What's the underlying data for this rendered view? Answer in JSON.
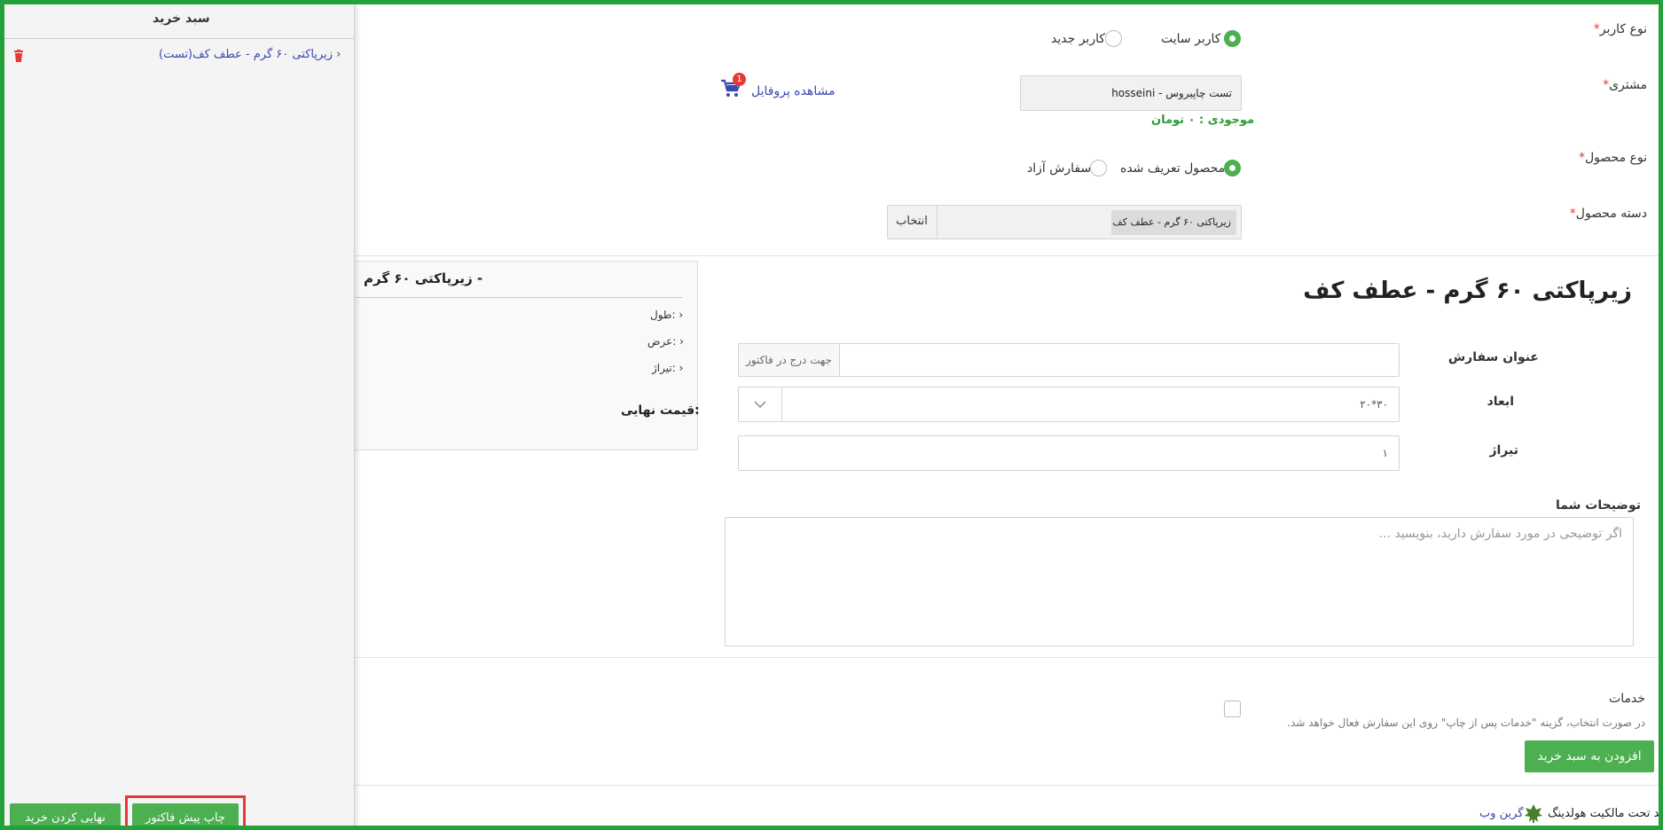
{
  "form": {
    "user_type": {
      "label": "نوع کاربر",
      "options": [
        "کاربر سایت",
        "کاربر جدید"
      ]
    },
    "customer": {
      "label": "مشتری",
      "value": "تست چاپیروس - hosseini",
      "balance": "موجودی : ۰ تومان",
      "profile_link": "مشاهده پروفایل",
      "cart_badge": "1"
    },
    "product_type": {
      "label": "نوع محصول",
      "options": [
        "محصول تعریف شده",
        "سفارش آزاد"
      ]
    },
    "category": {
      "label": "دسته محصول",
      "chip": "زیرپاکتی ۶۰ گرم - عطف کف",
      "select_button": "انتخاب"
    },
    "required_mark": "*"
  },
  "product": {
    "title": "زیرپاکتی ۶۰ گرم - عطف کف",
    "order_title_label": "عنوان سفارش",
    "order_title_addon": "جهت درج در فاکتور",
    "dimensions_label": "ابعاد",
    "dimensions_value": "۳۰*۲۰",
    "quantity_label": "تیراژ",
    "quantity_value": "۱",
    "notes_label": "توضیحات شما",
    "notes_placeholder": "اگر توضیحی در مورد سفارش دارید، بنویسید ..."
  },
  "summary": {
    "title": "زیرپاکتی ۶۰ گرم -",
    "length": "طول:",
    "width": "عرض:",
    "quantity": "تیراژ:",
    "final_price": "قیمت نهایی:"
  },
  "services": {
    "label": "خدمات",
    "note": "در صورت انتخاب، گزینه \"خدمات پس از چاپ\" روی این سفارش فعال خواهد شد.",
    "add_to_cart": "افزودن به سبد خرید"
  },
  "footer": {
    "text": "برند تحت مالکیت هولدینگ",
    "brand": "گرین وب"
  },
  "cart": {
    "title": "سبد خرید",
    "item": "زیرپاکتی ۶۰ گرم - عطف کف(تست)",
    "print_button": "چاپ پیش فاکتور",
    "finalize_button": "نهایی کردن خرید"
  },
  "colors": {
    "accent": "#4caf50",
    "link": "#3949ab",
    "frame": "#25a13a",
    "highlight": "#e53935",
    "delete": "#e53935"
  },
  "icons": [
    "cart-icon",
    "trash-icon",
    "chevron-icon",
    "leaf-logo-icon"
  ]
}
